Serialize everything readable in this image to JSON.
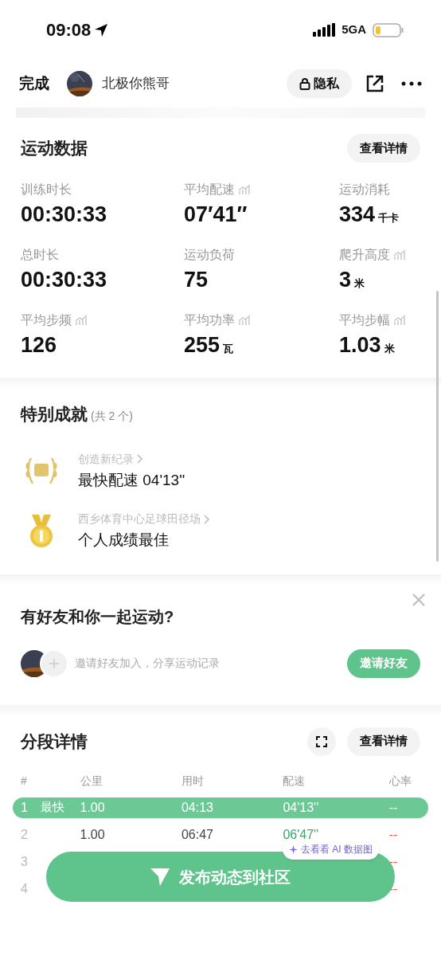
{
  "status_bar": {
    "time": "09:08",
    "network": "5GA"
  },
  "nav": {
    "done": "完成",
    "user_name": "北极你熊哥",
    "privacy": "隐私"
  },
  "stats": {
    "title": "运动数据",
    "details_button": "查看详情",
    "items": [
      {
        "label": "训练时长",
        "value": "00:30:33",
        "trend": false
      },
      {
        "label": "平均配速",
        "value": "07′41″",
        "trend": true
      },
      {
        "label": "运动消耗",
        "value": "334",
        "unit": "千卡",
        "trend": false
      },
      {
        "label": "总时长",
        "value": "00:30:33",
        "trend": false
      },
      {
        "label": "运动负荷",
        "value": "75",
        "trend": false
      },
      {
        "label": "爬升高度",
        "value": "3",
        "unit": "米",
        "trend": true
      },
      {
        "label": "平均步频",
        "value": "126",
        "trend": true
      },
      {
        "label": "平均功率",
        "value": "255",
        "unit": "瓦",
        "trend": true
      },
      {
        "label": "平均步幅",
        "value": "1.03",
        "unit": "米",
        "trend": true
      }
    ]
  },
  "achievements": {
    "title": "特别成就",
    "count": "(共 2 个)",
    "items": [
      {
        "kind": "pb",
        "category": "创造新纪录",
        "text": "最快配速 04'13''"
      },
      {
        "kind": "medal",
        "category": "西乡体育中心足球田径场",
        "text": "个人成绩最佳"
      }
    ]
  },
  "friends": {
    "title": "有好友和你一起运动?",
    "hint": "邀请好友加入，分享运动记录",
    "invite_button": "邀请好友"
  },
  "splits": {
    "title": "分段详情",
    "details_button": "查看详情",
    "columns": [
      "#",
      "公里",
      "用时",
      "配速",
      "心率"
    ],
    "rows": [
      {
        "index": "1",
        "badge": "最快",
        "km": "1.00",
        "time": "04:13",
        "pace": "04'13''",
        "heart_rate": "--",
        "selected": true
      },
      {
        "index": "2",
        "km": "1.00",
        "time": "06:47",
        "pace": "06'47''",
        "heart_rate": "--",
        "selected": false
      },
      {
        "index": "3",
        "heart_rate": "--",
        "selected": false
      },
      {
        "index": "4",
        "heart_rate": "--",
        "selected": false
      }
    ]
  },
  "ai_tip": "去看看 AI 数据图",
  "publish_button": "发布动态到社区"
}
